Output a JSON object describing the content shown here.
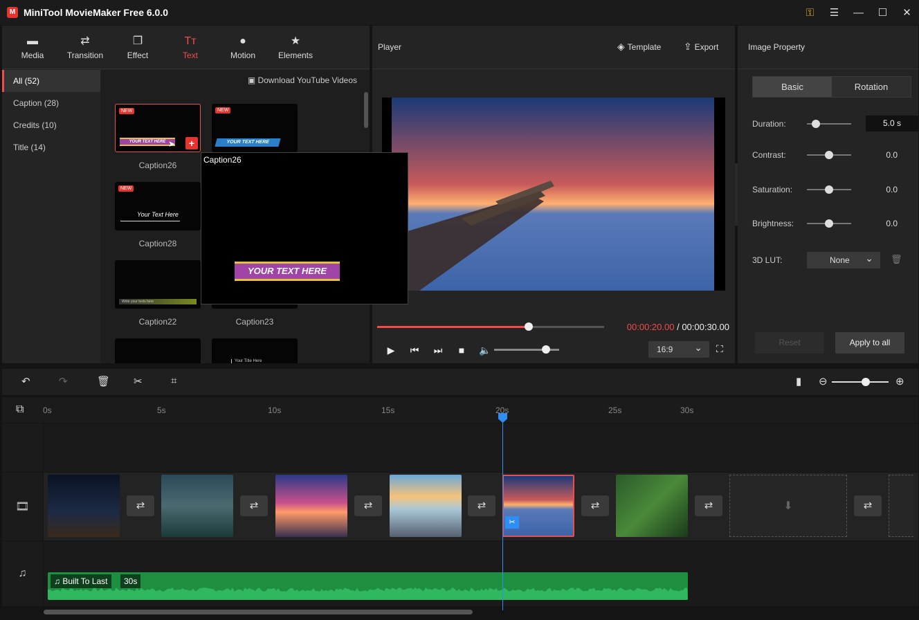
{
  "app": {
    "title": "MiniTool MovieMaker Free 6.0.0",
    "logo": "M"
  },
  "window_controls": [
    "key-icon",
    "menu-icon",
    "minimize-icon",
    "maximize-icon",
    "close-icon"
  ],
  "tool_tabs": [
    {
      "label": "Media",
      "icon": "▬"
    },
    {
      "label": "Transition",
      "icon": "⇄"
    },
    {
      "label": "Effect",
      "icon": "❐"
    },
    {
      "label": "Text",
      "icon": "Tт"
    },
    {
      "label": "Motion",
      "icon": "●"
    },
    {
      "label": "Elements",
      "icon": "★"
    }
  ],
  "categories": [
    "All (52)",
    "Caption (28)",
    "Credits (10)",
    "Title (14)"
  ],
  "download_youtube": "Download YouTube Videos",
  "thumbs": [
    {
      "label": "Caption26",
      "new": "NEW",
      "text": "YOUR TEXT HERE"
    },
    {
      "label": "",
      "new": "NEW",
      "text": "YOUR TEXT HERE"
    },
    {
      "label": "Caption28",
      "new": "NEW",
      "text": "Your Text Here"
    },
    {
      "label": "Caption22",
      "text": "Write your texts here"
    },
    {
      "label": "Caption23"
    },
    {
      "label": ""
    },
    {
      "label": "",
      "text": "Your Title Here"
    }
  ],
  "preview_popup": {
    "title": "Caption26",
    "banner": "YOUR TEXT HERE"
  },
  "player": {
    "title": "Player",
    "template_label": "Template",
    "export_label": "Export",
    "current_time": "00:00:20.00",
    "separator": " / ",
    "total_time": "00:00:30.00",
    "progress": 0.667,
    "volume": 0.8,
    "aspect_ratio": "16:9"
  },
  "properties": {
    "title": "Image Property",
    "tabs": [
      "Basic",
      "Rotation"
    ],
    "rows": [
      {
        "label": "Duration:",
        "value": "5.0 s",
        "pos": 0.2
      },
      {
        "label": "Contrast:",
        "value": "0.0",
        "pos": 0.5
      },
      {
        "label": "Saturation:",
        "value": "0.0",
        "pos": 0.5
      },
      {
        "label": "Brightness:",
        "value": "0.0",
        "pos": 0.5
      }
    ],
    "lut_label": "3D LUT:",
    "lut_value": "None",
    "reset_label": "Reset",
    "apply_label": "Apply to all"
  },
  "timeline": {
    "ticks": [
      "0s",
      "5s",
      "10s",
      "15s",
      "20s",
      "25s",
      "30s"
    ],
    "zoom": 0.6,
    "audio_name": "Built To Last",
    "audio_duration": "30s"
  },
  "colors": {
    "accent": "#ef4c4c",
    "playhead": "#2f8ef4",
    "audio": "#1e8e40"
  }
}
